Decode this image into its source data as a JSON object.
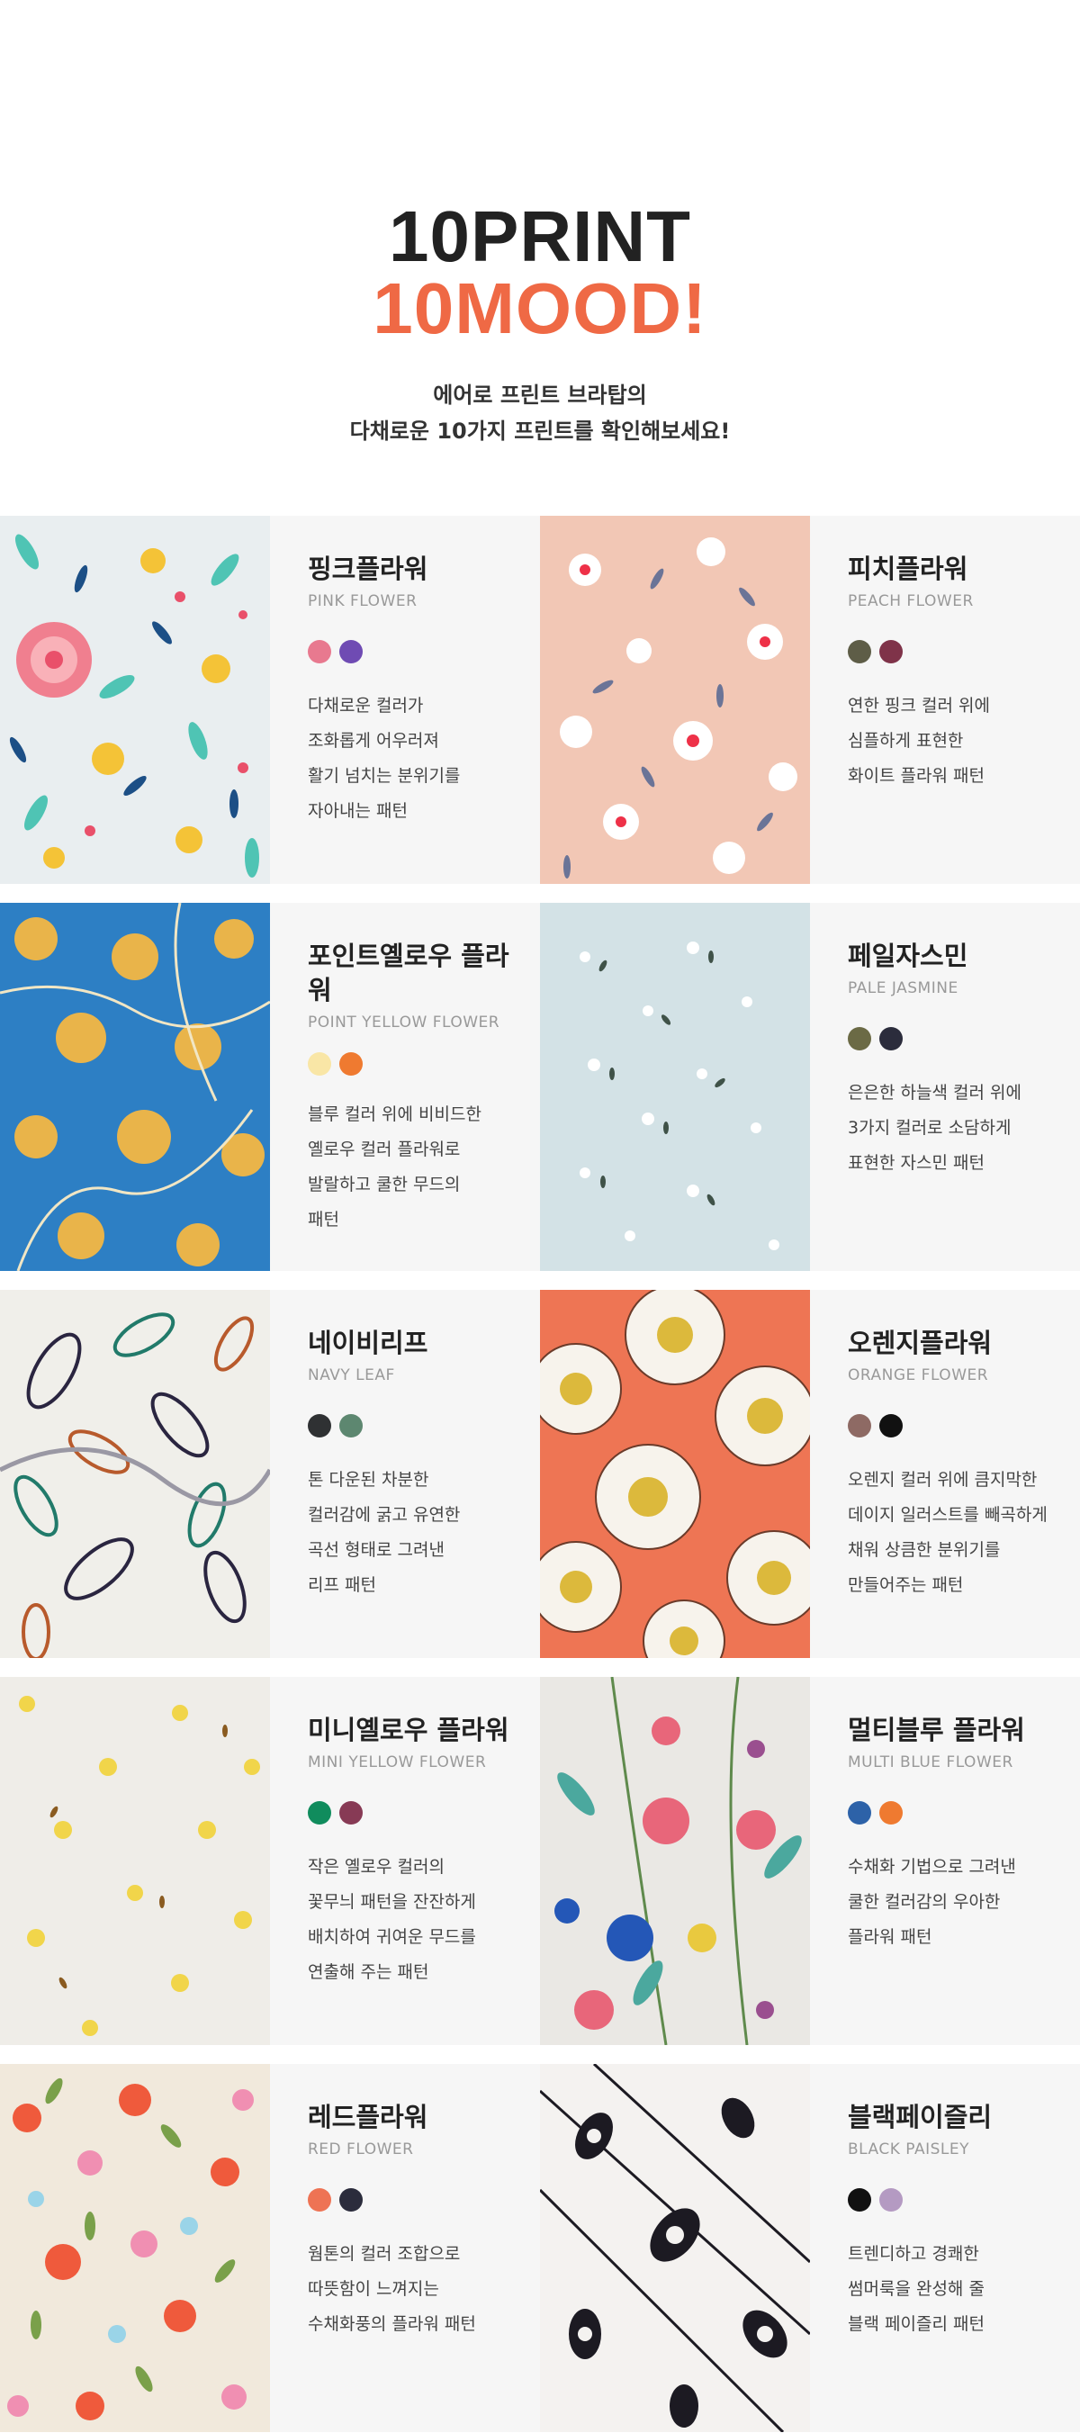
{
  "hero": {
    "title_line1": "10PRINT",
    "title_line2": "10MOOD!",
    "subtitle_line1": "에어로 프린트 브라탑의",
    "subtitle_line2": "다채로운 10가지 프린트를 확인해보세요!"
  },
  "patterns": [
    {
      "name_ko": "핑크플라워",
      "name_en": "PINK FLOWER",
      "colors": [
        "#e8798f",
        "#6f4bb3"
      ],
      "desc": [
        "다채로운 컬러가",
        "조화롭게 어우러져",
        "활기 넘치는 분위기를",
        "자아내는 패턴"
      ]
    },
    {
      "name_ko": "피치플라워",
      "name_en": "PEACH FLOWER",
      "colors": [
        "#5e5d47",
        "#7f3349"
      ],
      "desc": [
        "연한 핑크 컬러 위에",
        "심플하게 표현한",
        "화이트 플라워 패턴"
      ]
    },
    {
      "name_ko": "포인트옐로우 플라워",
      "name_en": "POINT YELLOW FLOWER",
      "colors": [
        "#f9e6a6",
        "#ef7a30"
      ],
      "desc": [
        "블루 컬러 위에 비비드한",
        "옐로우 컬러 플라워로",
        "발랄하고 쿨한 무드의",
        "패턴"
      ]
    },
    {
      "name_ko": "페일자스민",
      "name_en": "PALE JASMINE",
      "colors": [
        "#6b6a45",
        "#2b2c3c"
      ],
      "desc": [
        "은은한 하늘색 컬러 위에",
        "3가지 컬러로 소담하게",
        "표현한 자스민 패턴"
      ]
    },
    {
      "name_ko": "네이비리프",
      "name_en": "NAVY LEAF",
      "colors": [
        "#2f3133",
        "#5d8770"
      ],
      "desc": [
        "톤 다운된 차분한",
        "컬러감에 굵고 유연한",
        "곡선 형태로 그려낸",
        "리프 패턴"
      ]
    },
    {
      "name_ko": "오렌지플라워",
      "name_en": "ORANGE FLOWER",
      "colors": [
        "#8e6a64",
        "#111111"
      ],
      "desc": [
        "오렌지 컬러 위에 큼지막한",
        "데이지 일러스트를 빼곡하게",
        "채워  상큼한 분위기를",
        "만들어주는 패턴"
      ]
    },
    {
      "name_ko": "미니옐로우 플라워",
      "name_en": "MINI YELLOW FLOWER",
      "colors": [
        "#108c5d",
        "#873a55"
      ],
      "desc": [
        "작은 옐로우 컬러의",
        "꽃무늬 패턴을 잔잔하게",
        "배치하여 귀여운 무드를",
        "연출해 주는 패턴"
      ]
    },
    {
      "name_ko": "멀티블루 플라워",
      "name_en": "MULTI BLUE FLOWER",
      "colors": [
        "#2d62a8",
        "#ef7a30"
      ],
      "desc": [
        "수채화 기법으로 그려낸",
        "쿨한 컬러감의 우아한",
        "플라워 패턴"
      ]
    },
    {
      "name_ko": "레드플라워",
      "name_en": "RED FLOWER",
      "colors": [
        "#ee7354",
        "#2b2c3c"
      ],
      "desc": [
        "웜톤의 컬러 조합으로",
        "따뜻함이 느껴지는",
        "수채화풍의 플라워 패턴"
      ]
    },
    {
      "name_ko": "블랙페이즐리",
      "name_en": "BLACK PAISLEY",
      "colors": [
        "#111111",
        "#b49ac2"
      ],
      "desc": [
        "트렌디하고 경쾌한",
        "썸머룩을 완성해 줄",
        "블랙 페이즐리 패턴"
      ]
    }
  ]
}
